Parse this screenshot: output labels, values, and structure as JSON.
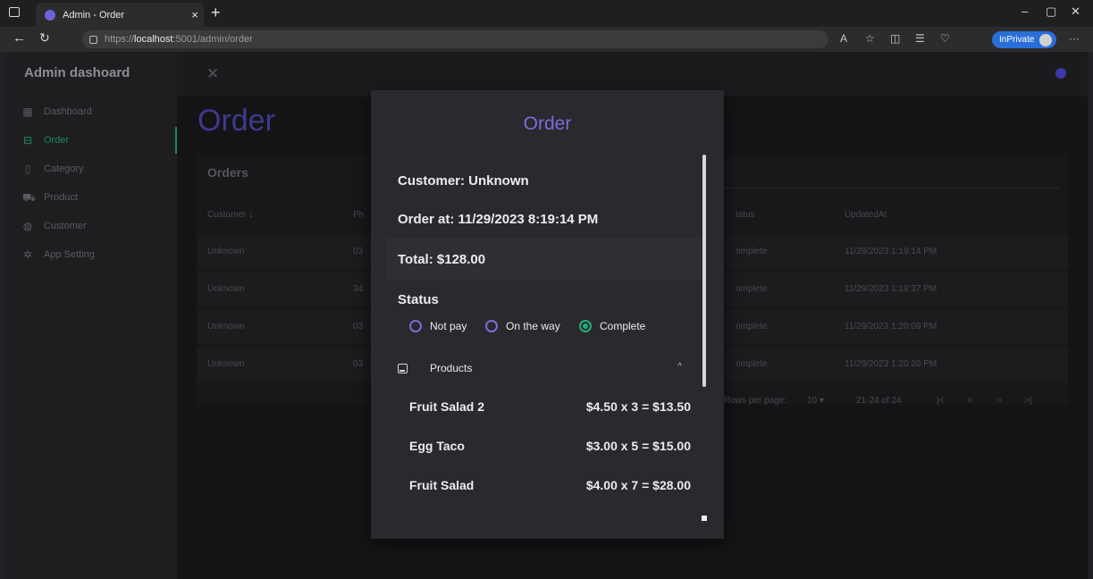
{
  "browser": {
    "tab_title": "Admin - Order",
    "tab_close": "×",
    "new_tab": "+",
    "url_prefix": "https://",
    "url_host": "localhost",
    "url_rest": ":5001/admin/order",
    "inprivate_label": "InPrivate",
    "window_controls": {
      "minimize": "–",
      "restore": "▢",
      "close": "✕"
    },
    "toolbar_icons": [
      "read-aloud-icon",
      "favorite-star-icon",
      "split-screen-icon",
      "favorites-icon",
      "browser-essentials-icon",
      "more-icon"
    ]
  },
  "sidebar": {
    "brand": "Admin dashoard",
    "items": [
      {
        "label": "Dashboard",
        "icon": "dashboard-icon",
        "active": false
      },
      {
        "label": "Order",
        "icon": "table-icon",
        "active": true
      },
      {
        "label": "Category",
        "icon": "bookmark-icon",
        "active": false
      },
      {
        "label": "Product",
        "icon": "cart-icon",
        "active": false
      },
      {
        "label": "Customer",
        "icon": "globe-icon",
        "active": false
      },
      {
        "label": "App Setting",
        "icon": "gear-icon",
        "active": false
      }
    ]
  },
  "main": {
    "page_title": "Order",
    "card_title": "Orders",
    "columns": {
      "customer": "Customer",
      "phone": "Ph",
      "status": "tatus",
      "updated": "UpdatedAt"
    },
    "rows": [
      {
        "customer": "Unknown",
        "phone": "03",
        "status": "omplete",
        "updated": "11/29/2023 1:19:14 PM"
      },
      {
        "customer": "Unknown",
        "phone": "34",
        "status": "omplete",
        "updated": "11/29/2023 1:19:37 PM"
      },
      {
        "customer": "Unknown",
        "phone": "03",
        "status": "omplete",
        "updated": "11/29/2023 1:20:09 PM"
      },
      {
        "customer": "Unknown",
        "phone": "03",
        "status": "omplete",
        "updated": "11/29/2023 1:20:20 PM"
      }
    ],
    "pager": {
      "rows_label": "Rows per page:",
      "rows_value": "10",
      "range": "21-24 of 24"
    }
  },
  "modal": {
    "title": "Order",
    "customer": "Customer: Unknown",
    "order_at": "Order at: 11/29/2023 8:19:14 PM",
    "total": "Total: $128.00",
    "status_label": "Status",
    "status_options": [
      {
        "label": "Not pay",
        "selected": false
      },
      {
        "label": "On the way",
        "selected": false
      },
      {
        "label": "Complete",
        "selected": true
      }
    ],
    "products_label": "Products",
    "products": [
      {
        "name": "Fruit Salad 2",
        "calc": "$4.50 x 3 = $13.50"
      },
      {
        "name": "Egg Taco",
        "calc": "$3.00 x 5 = $15.00"
      },
      {
        "name": "Fruit Salad",
        "calc": "$4.00 x 7 = $28.00"
      }
    ]
  },
  "colors": {
    "accent": "#7e6ad8",
    "active_nav": "#1c8a5d",
    "complete": "#22b07a"
  }
}
